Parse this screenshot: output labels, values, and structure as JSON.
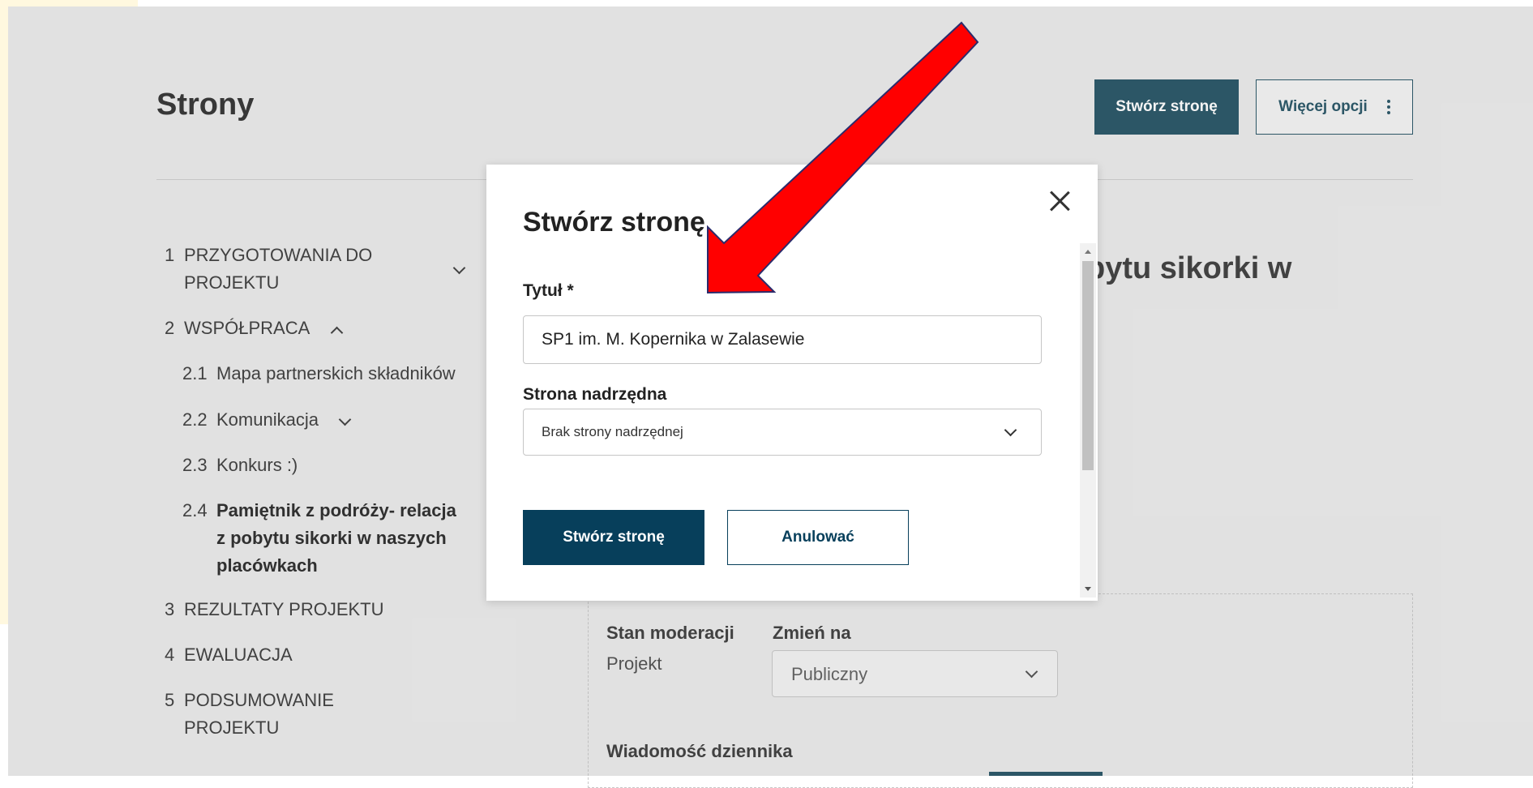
{
  "page": {
    "title": "Strony",
    "create_button": "Stwórz stronę",
    "more_button": "Więcej opcji"
  },
  "nav": {
    "items": [
      {
        "num": "1",
        "label_line1": "PRZYGOTOWANIA DO",
        "label_line2": "PROJEKTU"
      },
      {
        "num": "2",
        "label": "WSPÓŁPRACA"
      },
      {
        "num": "2.1",
        "label": "Mapa partnerskich składników"
      },
      {
        "num": "2.2",
        "label": "Komunikacja"
      },
      {
        "num": "2.3",
        "label": "Konkurs :)"
      },
      {
        "num": "2.4",
        "label_line1": "Pamiętnik z podróży- relacja",
        "label_line2": "z pobytu sikorki w naszych",
        "label_line3": "placówkach"
      },
      {
        "num": "3",
        "label": "REZULTATY PROJEKTU"
      },
      {
        "num": "4",
        "label": "EWALUACJA"
      },
      {
        "num": "5",
        "label_line1": "PODSUMOWANIE",
        "label_line2": "PROJEKTU"
      }
    ]
  },
  "main": {
    "heading_fragment": "bytu sikorki w",
    "moderation_label": "Stan moderacji",
    "moderation_value": "Projekt",
    "change_to_label": "Zmień na",
    "change_to_value": "Publiczny",
    "log_label": "Wiadomość dziennika"
  },
  "modal": {
    "title": "Stwórz stronę",
    "title_field_label": "Tytuł *",
    "title_field_value": "SP1 im. M. Kopernika w Zalasewie",
    "parent_label": "Strona nadrzędna",
    "parent_value": "Brak strony nadrzędnej",
    "submit_label": "Stwórz stronę",
    "cancel_label": "Anulować"
  },
  "colors": {
    "accent": "#2f5a6b",
    "primary_dark": "#073f5b",
    "annotation_arrow": "#ff0000"
  },
  "icons": [
    "close-icon",
    "chevron-down-icon",
    "chevron-up-icon",
    "kebab-menu-icon",
    "annotation-arrow"
  ]
}
